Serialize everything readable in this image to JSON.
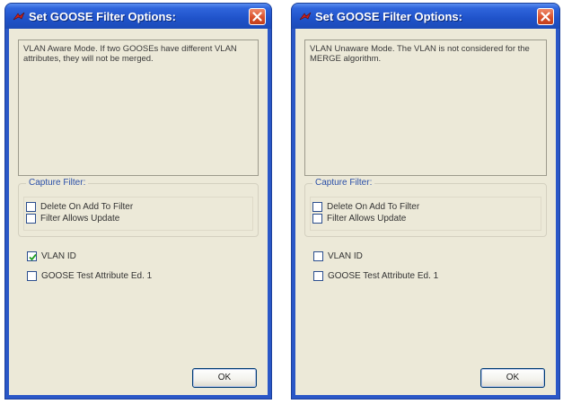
{
  "windows": [
    {
      "title": "Set GOOSE Filter Options:",
      "description": "VLAN Aware Mode. If two GOOSEs have different VLAN attributes, they will not be merged.",
      "capture_filter": {
        "legend": "Capture Filter:",
        "delete_on_add": {
          "label": "Delete On Add To Filter",
          "checked": false
        },
        "filter_allows_update": {
          "label": "Filter Allows Update",
          "checked": false
        }
      },
      "vlan_id": {
        "label": "VLAN ID",
        "checked": true
      },
      "goose_test": {
        "label": "GOOSE Test Attribute Ed. 1",
        "checked": false
      },
      "ok_label": "OK"
    },
    {
      "title": "Set GOOSE Filter Options:",
      "description": "VLAN Unaware Mode. The VLAN is not considered for the MERGE algorithm.",
      "capture_filter": {
        "legend": "Capture Filter:",
        "delete_on_add": {
          "label": "Delete On Add To Filter",
          "checked": false
        },
        "filter_allows_update": {
          "label": "Filter Allows Update",
          "checked": false
        }
      },
      "vlan_id": {
        "label": "VLAN ID",
        "checked": false
      },
      "goose_test": {
        "label": "GOOSE Test Attribute Ed. 1",
        "checked": false
      },
      "ok_label": "OK"
    }
  ],
  "theme": {
    "titlebar": "#2458d6",
    "client_bg": "#ece9d8",
    "close_button": "#d9512c",
    "legend_text": "#2a4fa8",
    "checkmark": "#21a121"
  },
  "icons": {
    "app": "app-icon",
    "close": "close-icon",
    "check": "checkmark-icon"
  }
}
